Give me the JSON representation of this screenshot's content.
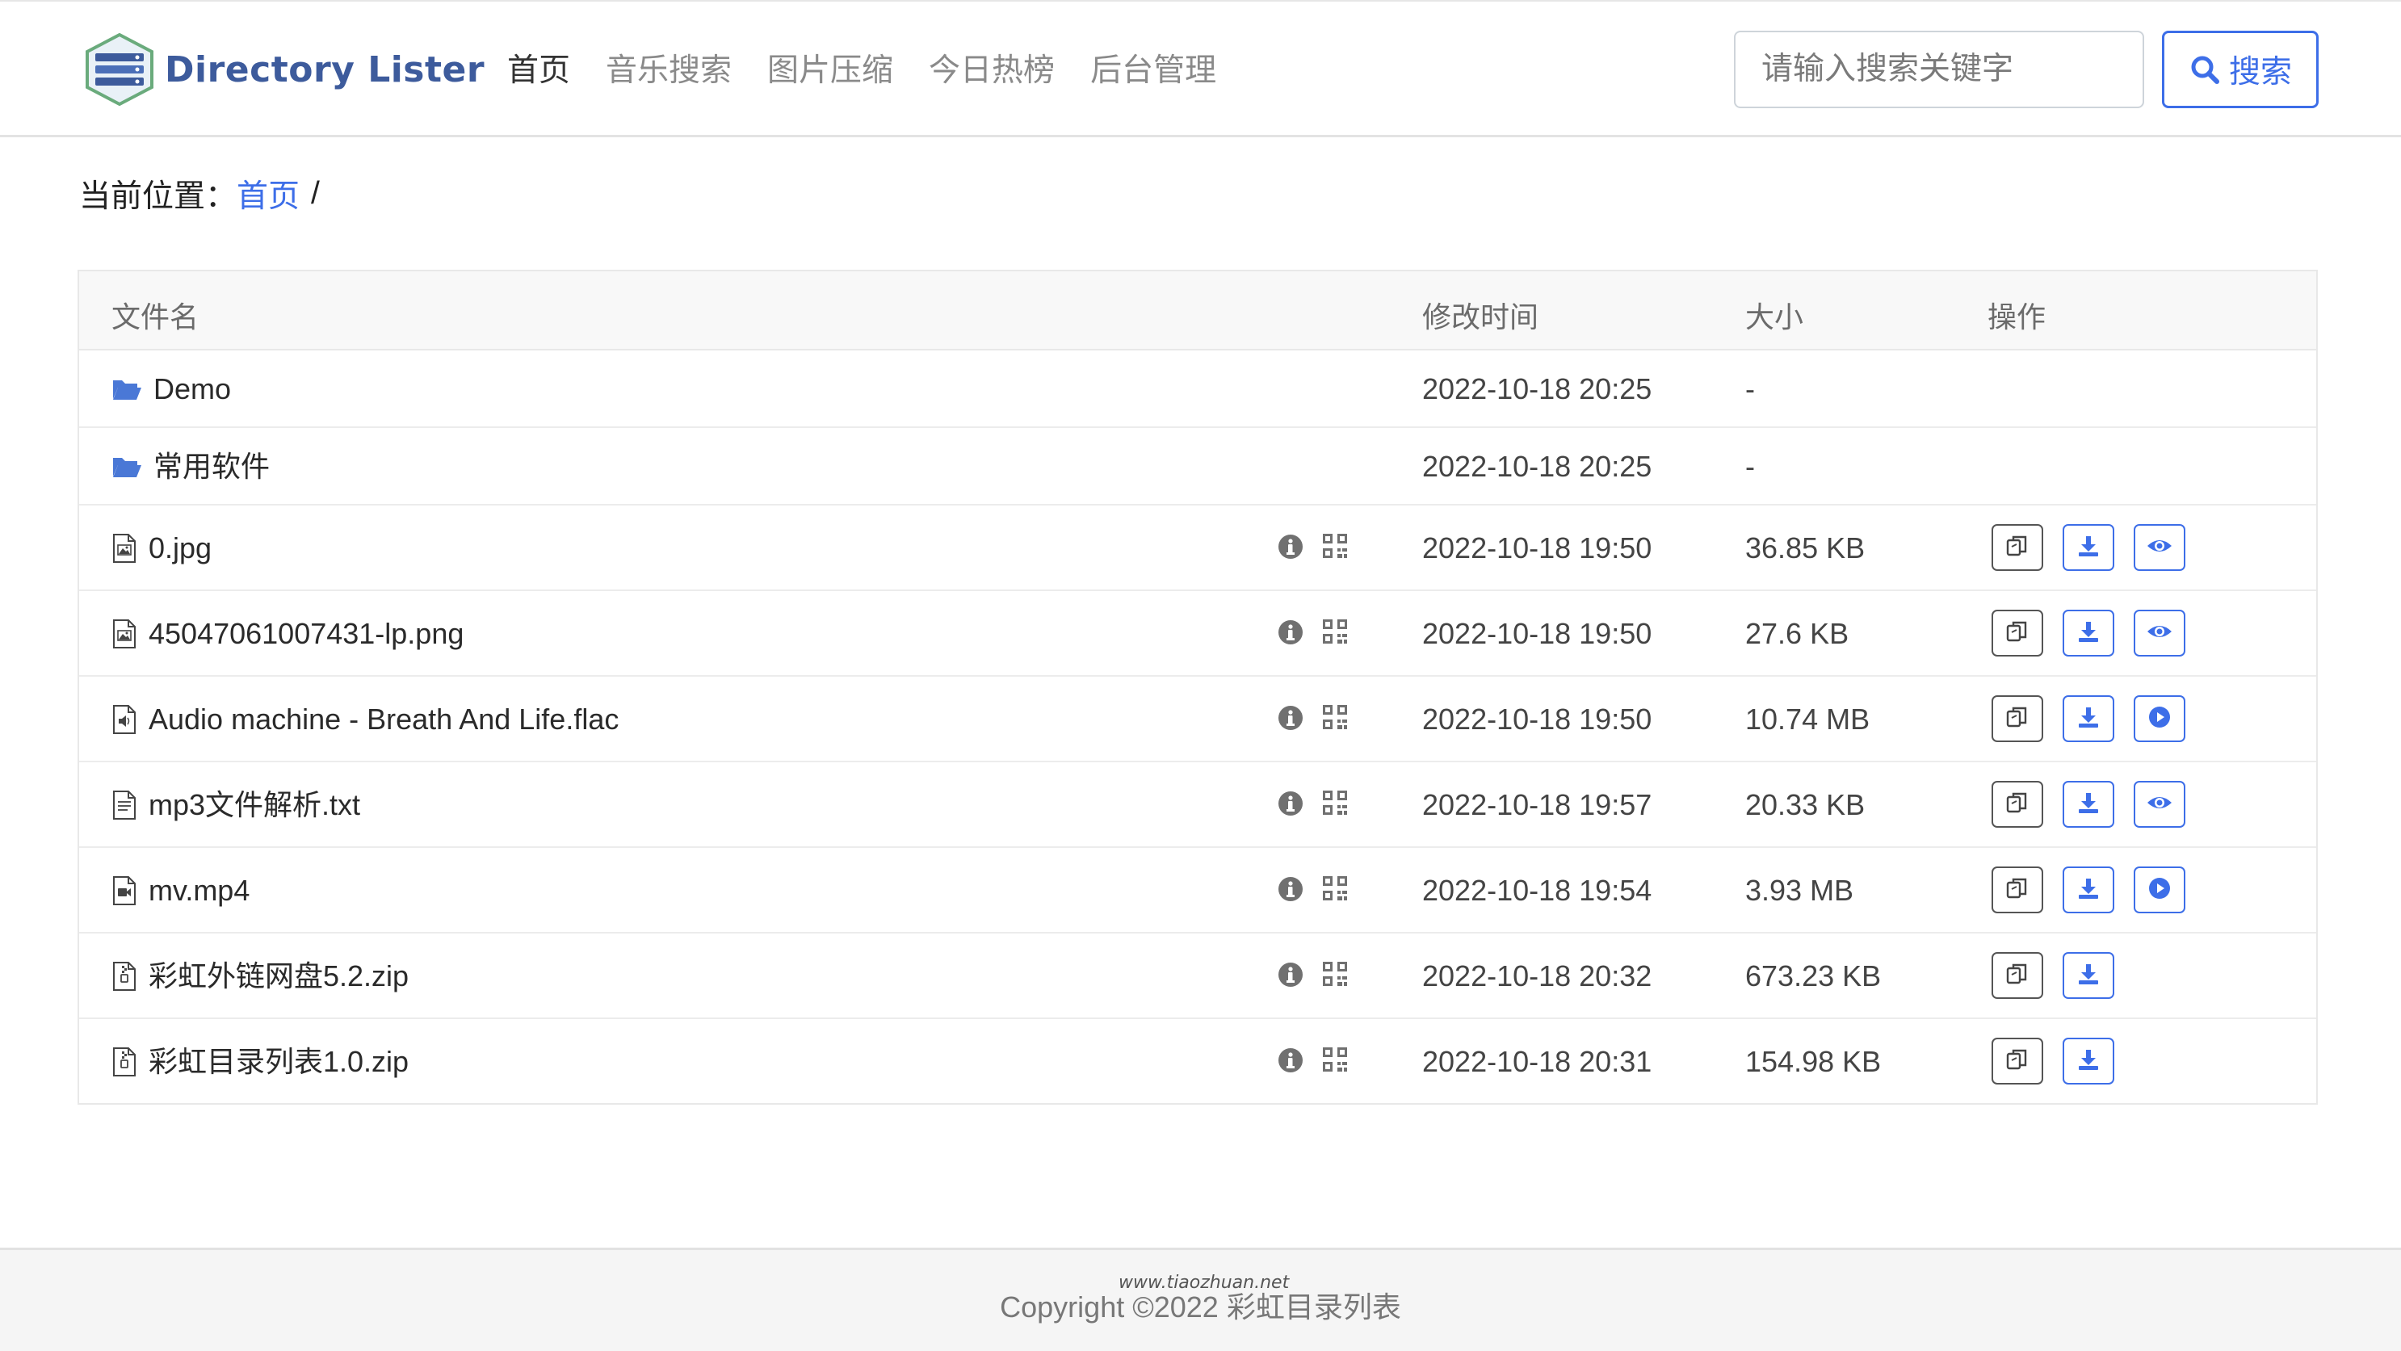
{
  "brand": {
    "name": "Directory Lister"
  },
  "nav": {
    "items": [
      {
        "label": "首页",
        "active": true
      },
      {
        "label": "音乐搜索",
        "active": false
      },
      {
        "label": "图片压缩",
        "active": false
      },
      {
        "label": "今日热榜",
        "active": false
      },
      {
        "label": "后台管理",
        "active": false
      }
    ]
  },
  "search": {
    "placeholder": "请输入搜索关键字",
    "value": "",
    "button_label": "搜索"
  },
  "breadcrumb": {
    "prefix": "当前位置：",
    "home": "首页",
    "separator": "/"
  },
  "table": {
    "headers": {
      "name": "文件名",
      "modified": "修改时间",
      "size": "大小",
      "actions": "操作"
    },
    "rows": [
      {
        "type": "folder",
        "name": "Demo",
        "modified": "2022-10-18 20:25",
        "size": "-"
      },
      {
        "type": "folder",
        "name": "常用软件",
        "modified": "2022-10-18 20:25",
        "size": "-"
      },
      {
        "type": "image",
        "name": "0.jpg",
        "modified": "2022-10-18 19:50",
        "size": "36.85 KB",
        "preview": "view"
      },
      {
        "type": "image",
        "name": "45047061007431-lp.png",
        "modified": "2022-10-18 19:50",
        "size": "27.6 KB",
        "preview": "view"
      },
      {
        "type": "audio",
        "name": "Audio machine - Breath And Life.flac",
        "modified": "2022-10-18 19:50",
        "size": "10.74 MB",
        "preview": "play"
      },
      {
        "type": "text",
        "name": "mp3文件解析.txt",
        "modified": "2022-10-18 19:57",
        "size": "20.33 KB",
        "preview": "view"
      },
      {
        "type": "video",
        "name": "mv.mp4",
        "modified": "2022-10-18 19:54",
        "size": "3.93 MB",
        "preview": "play"
      },
      {
        "type": "archive",
        "name": "彩虹外链网盘5.2.zip",
        "modified": "2022-10-18 20:32",
        "size": "673.23 KB",
        "preview": "none"
      },
      {
        "type": "archive",
        "name": "彩虹目录列表1.0.zip",
        "modified": "2022-10-18 20:31",
        "size": "154.98 KB",
        "preview": "none"
      }
    ]
  },
  "footer": {
    "copyright": "Copyright ©2022 彩虹目录列表",
    "watermark": "www.tiaozhuan.net"
  },
  "colors": {
    "accent": "#3d6ee8",
    "brand": "#3d5b9c",
    "folder": "#4a78d6"
  }
}
